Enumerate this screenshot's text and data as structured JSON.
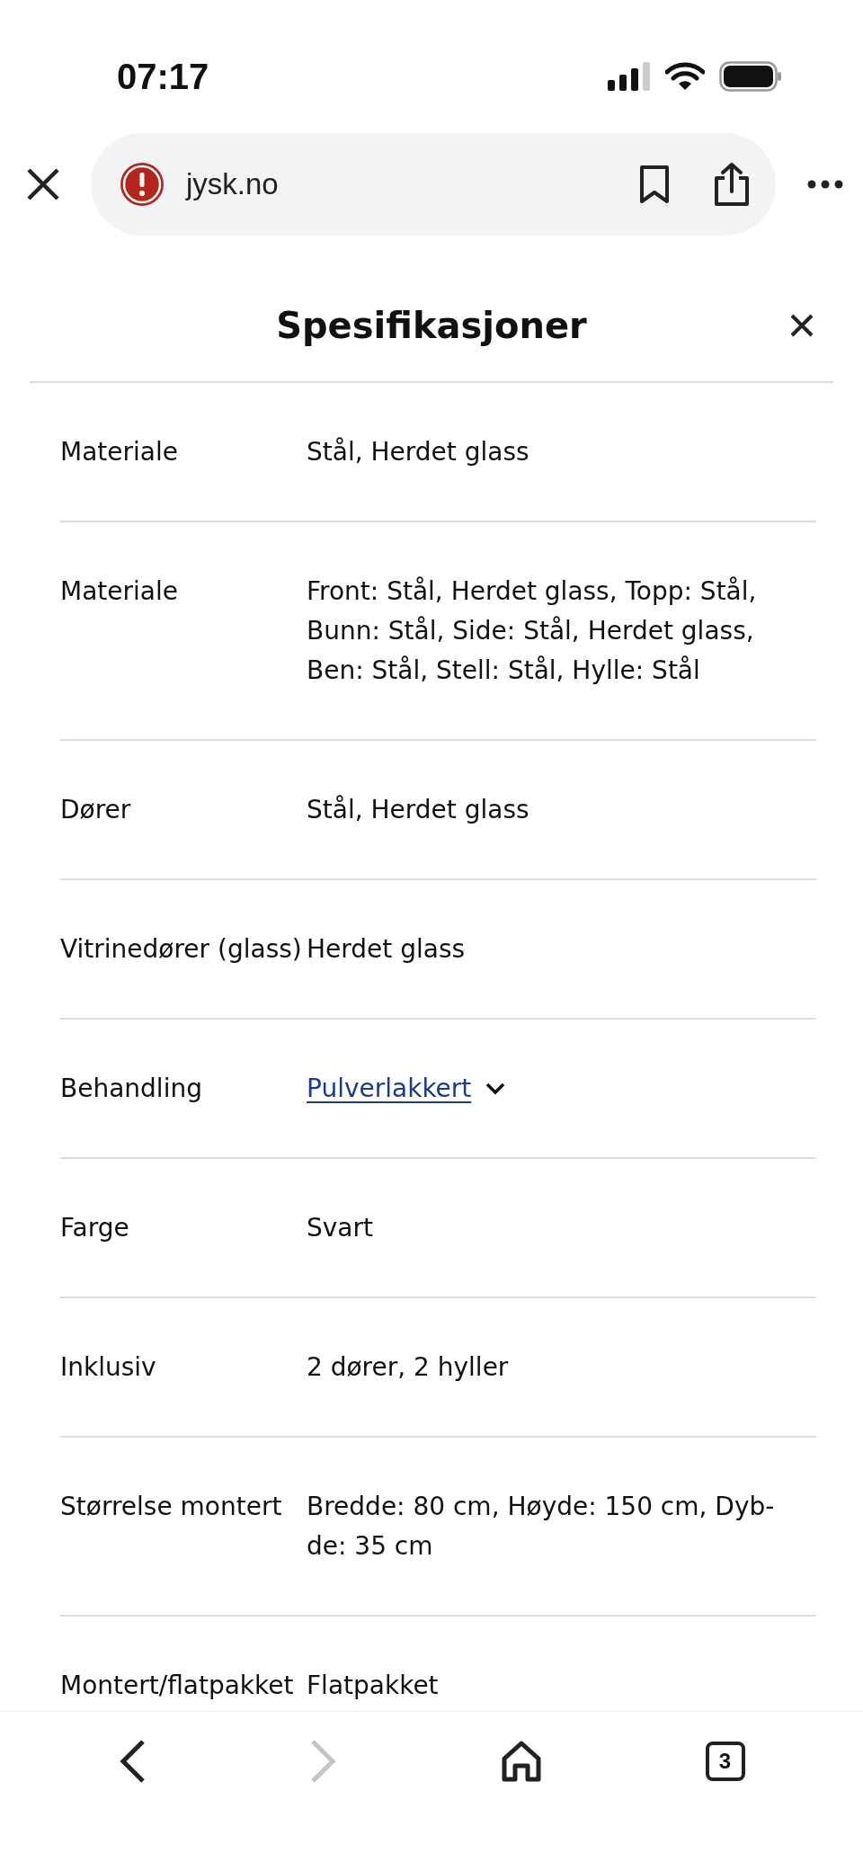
{
  "status_bar": {
    "time": "07:17"
  },
  "browser": {
    "url": "jysk.no"
  },
  "panel": {
    "title": "Spesifikasjoner"
  },
  "specs": [
    {
      "label": "Materiale",
      "kind": "text",
      "lines": [
        "Stål, Herdet glass"
      ]
    },
    {
      "label": "Materiale",
      "kind": "text",
      "lines": [
        "Front: Stål, Herdet glass, Topp: Stål,",
        "Bunn: Stål, Side: Stål, Herdet glass,",
        "Ben: Stål, Stell: Stål, Hylle: Stål"
      ]
    },
    {
      "label": "Dører",
      "kind": "text",
      "lines": [
        "Stål, Herdet glass"
      ]
    },
    {
      "label": "Vitrinedører (glass)",
      "kind": "text",
      "lines": [
        "Herdet glass"
      ]
    },
    {
      "label": "Behandling",
      "kind": "link",
      "expanded": false,
      "lines": [
        "Pulverlakkert"
      ]
    },
    {
      "label": "Farge",
      "kind": "text",
      "lines": [
        "Svart"
      ]
    },
    {
      "label": "Inklusiv",
      "kind": "text",
      "lines": [
        "2 dører, 2 hyller"
      ]
    },
    {
      "label": "Størrelse montert",
      "kind": "text",
      "lines": [
        "Bredde: 80 cm, Høyde: 150 cm, Dyb-",
        "de: 35 cm"
      ]
    },
    {
      "label": "Montert/flatpakket",
      "kind": "text",
      "lines": [
        "Flatpakket"
      ]
    }
  ],
  "toolbar": {
    "back": {
      "disabled": false
    },
    "forward": {
      "disabled": true
    },
    "tab_count": "3"
  }
}
